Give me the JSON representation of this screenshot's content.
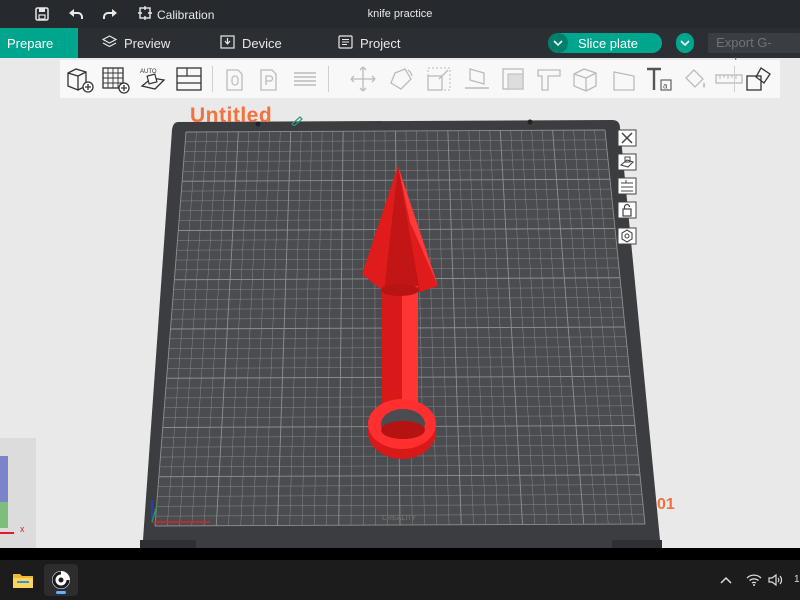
{
  "titlebar": {
    "calibration_label": "Calibration",
    "project_title": "knife practice",
    "icons": [
      "save-icon",
      "undo-icon",
      "redo-icon",
      "calibration-icon"
    ]
  },
  "menubar": {
    "prepare": "Prepare",
    "preview": "Preview",
    "device": "Device",
    "project": "Project",
    "slice_plate": "Slice plate",
    "export_gcode": "Export G-code"
  },
  "toolbar": {
    "tools": [
      "add-object-icon",
      "add-plate-icon",
      "auto-arrange-icon",
      "arrange-plates-icon",
      "orient-icon",
      "plate-icon",
      "layers-icon",
      "move-icon",
      "rotate-icon",
      "scale-icon",
      "lay-on-face-icon",
      "cut-icon",
      "support-paint-icon",
      "seam-paint-icon",
      "variable-height-icon",
      "text-icon",
      "color-paint-icon",
      "measure-icon",
      "assembly-icon"
    ],
    "auto_label": "AUTO"
  },
  "plate": {
    "name": "Untitled",
    "number": "01",
    "brand": "CREALITY",
    "model_color": "#e01b1b",
    "side_tools": [
      "close-icon",
      "orient-plate-icon",
      "arrange-plate-icon",
      "lock-icon",
      "settings-icon"
    ]
  },
  "axes": {
    "x_label": "x"
  },
  "taskbar": {
    "apps": [
      "file-explorer-icon",
      "creality-print-icon"
    ],
    "tray": [
      "chevron-up-icon",
      "wifi-icon",
      "volume-icon"
    ],
    "clock_fragment": "1"
  },
  "colors": {
    "accent": "#00a58e",
    "title_bar": "#262a2e",
    "menu_bar": "#2b2f33",
    "plate_bg": "#4b4c4f",
    "grid_line": "#8e8f92",
    "orange_label": "#f2713c"
  }
}
